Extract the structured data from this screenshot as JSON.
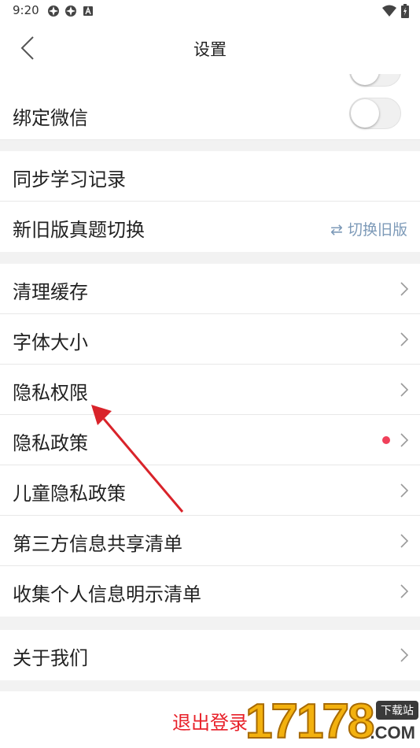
{
  "status": {
    "time": "9:20"
  },
  "header": {
    "title": "设置"
  },
  "social": {
    "wechat_label": "绑定微信"
  },
  "sync": {
    "items": [
      {
        "label": "同步学习记录"
      },
      {
        "label": "新旧版真题切换",
        "action": "⇄ 切换旧版"
      }
    ]
  },
  "general": {
    "items": [
      {
        "label": "清理缓存"
      },
      {
        "label": "字体大小"
      },
      {
        "label": "隐私权限"
      },
      {
        "label": "隐私政策"
      },
      {
        "label": "儿童隐私政策"
      },
      {
        "label": "第三方信息共享清单"
      },
      {
        "label": "收集个人信息明示清单"
      }
    ]
  },
  "about": {
    "label": "关于我们"
  },
  "logout": {
    "label": "退出登录"
  },
  "watermark": {
    "number": "17178",
    "badge": "下载站",
    "domain": ".COM"
  },
  "colors": {
    "accent_red": "#e8212a",
    "link_blue": "#7d9ab8",
    "dot": "#f0405a",
    "arrow": "#d9232a"
  }
}
